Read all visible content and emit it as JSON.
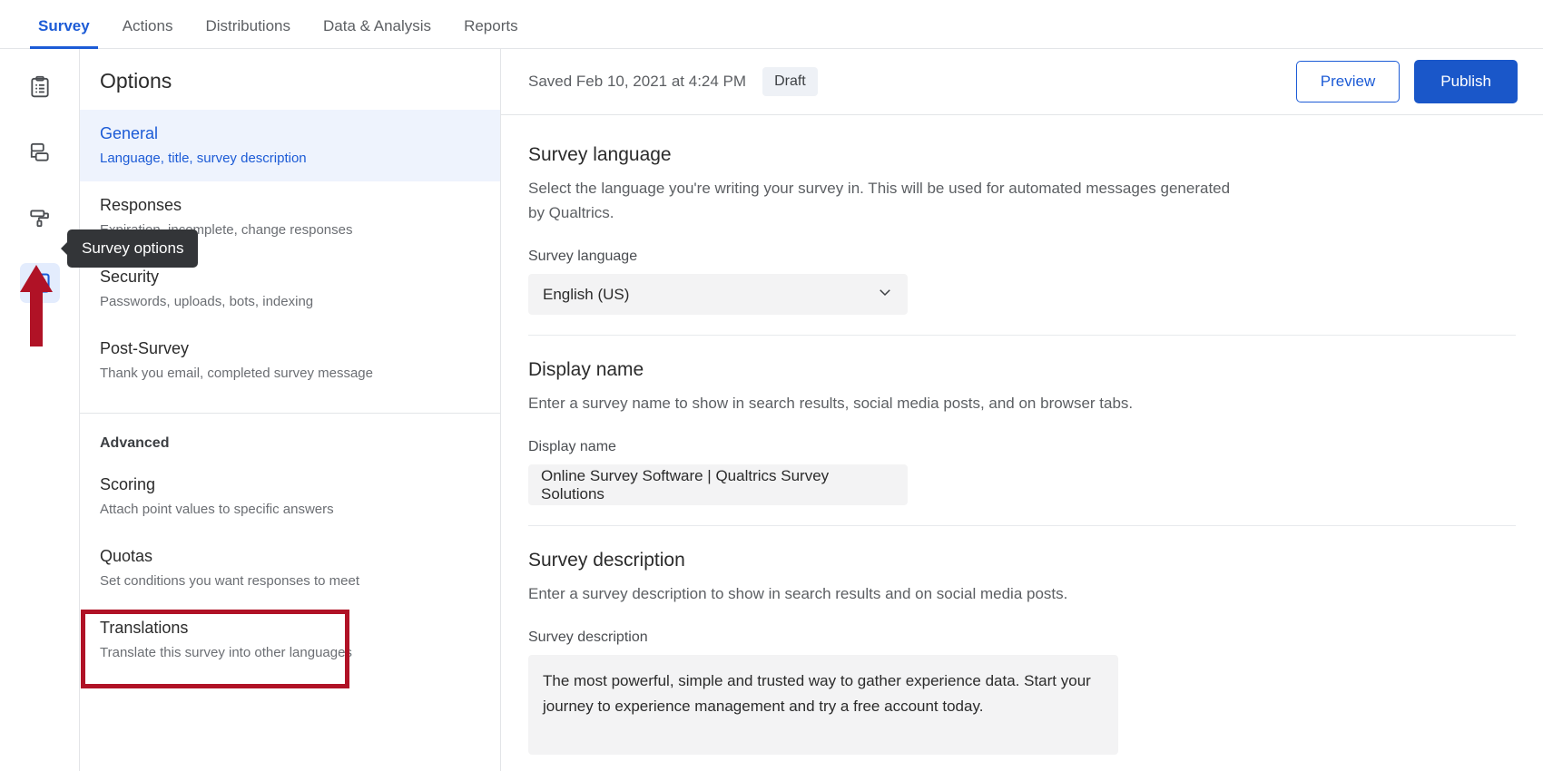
{
  "topnav": {
    "tabs": [
      {
        "label": "Survey",
        "active": true
      },
      {
        "label": "Actions",
        "active": false
      },
      {
        "label": "Distributions",
        "active": false
      },
      {
        "label": "Data & Analysis",
        "active": false
      },
      {
        "label": "Reports",
        "active": false
      }
    ]
  },
  "rail": {
    "items": [
      {
        "icon": "clipboard-icon",
        "name": "survey-builder"
      },
      {
        "icon": "survey-flow-icon",
        "name": "survey-flow"
      },
      {
        "icon": "paint-roller-icon",
        "name": "look-and-feel"
      },
      {
        "icon": "survey-options-icon",
        "name": "survey-options"
      }
    ],
    "tooltip": "Survey options"
  },
  "options": {
    "title": "Options",
    "items": [
      {
        "name": "General",
        "desc": "Language, title, survey description",
        "selected": true
      },
      {
        "name": "Responses",
        "desc": "Expiration, incomplete, change responses",
        "selected": false
      },
      {
        "name": "Security",
        "desc": "Passwords, uploads, bots, indexing",
        "selected": false
      },
      {
        "name": "Post-Survey",
        "desc": "Thank you email, completed survey message",
        "selected": false
      }
    ],
    "advanced_label": "Advanced",
    "advanced_items": [
      {
        "name": "Scoring",
        "desc": "Attach point values to specific answers",
        "highlighted": false
      },
      {
        "name": "Quotas",
        "desc": "Set conditions you want responses to meet",
        "highlighted": false
      },
      {
        "name": "Translations",
        "desc": "Translate this survey into other languages",
        "highlighted": true
      }
    ]
  },
  "header": {
    "saved_text": "Saved Feb 10, 2021 at 4:24 PM",
    "status_badge": "Draft",
    "preview_label": "Preview",
    "publish_label": "Publish"
  },
  "main": {
    "language_section": {
      "title": "Survey language",
      "subtitle": "Select the language you're writing your survey in. This will be used for automated messages generated by Qualtrics.",
      "field_label": "Survey language",
      "value": "English (US)"
    },
    "display_name_section": {
      "title": "Display name",
      "subtitle": "Enter a survey name to show in search results, social media posts, and on browser tabs.",
      "field_label": "Display name",
      "value": "Online Survey Software | Qualtrics Survey Solutions"
    },
    "description_section": {
      "title": "Survey description",
      "subtitle": "Enter a survey description to show in search results and on social media posts.",
      "field_label": "Survey description",
      "value": "The most powerful, simple and trusted way to gather experience data. Start your journey to experience management and try a free account today."
    }
  },
  "colors": {
    "accent_blue": "#1c5bd6",
    "publish_blue": "#1a57c9",
    "selected_bg": "#eef3fd",
    "highlight_red": "#b01226",
    "tooltip_bg": "#333538",
    "field_bg": "#f3f3f4"
  }
}
